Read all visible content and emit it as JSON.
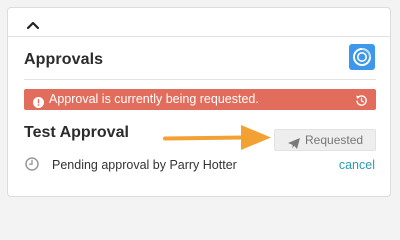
{
  "panel": {
    "title": "Approvals"
  },
  "alert": {
    "message": "Approval is currently being requested."
  },
  "approval": {
    "name": "Test Approval",
    "status_button_label": "Requested",
    "pending_text": "Pending approval by Parry Hotter",
    "cancel_label": "cancel"
  },
  "colors": {
    "alert_background": "#e26d5c",
    "app_icon_background": "#3d97ea",
    "annotation_arrow": "#f4a134",
    "link": "#2a9bb6"
  },
  "icons": {
    "collapse": "chevron-up-icon",
    "app": "approvals-app-icon",
    "alert": "exclamation-circle-icon",
    "refresh": "refresh-icon",
    "send": "paper-plane-icon",
    "pending": "clock-icon"
  }
}
